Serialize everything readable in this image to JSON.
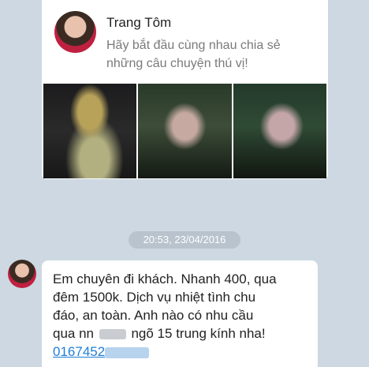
{
  "profile": {
    "name": "Trang Tôm",
    "status": "Hãy bắt đầu cùng nhau chia sẻ những câu chuyện thú vị!"
  },
  "chat": {
    "timestamp": "20:53, 23/04/2016",
    "message": {
      "line1": "Em chuyên đi khách. Nhanh 400, qua",
      "line2": "đêm 1500k. Dịch vụ nhiệt tình chu",
      "line3": "đáo, an toàn. Anh nào có nhu cầu",
      "line4_start": "qua nn",
      "line4_end": "ngõ 15 trung kính nha!",
      "link_visible": "0167452"
    }
  }
}
